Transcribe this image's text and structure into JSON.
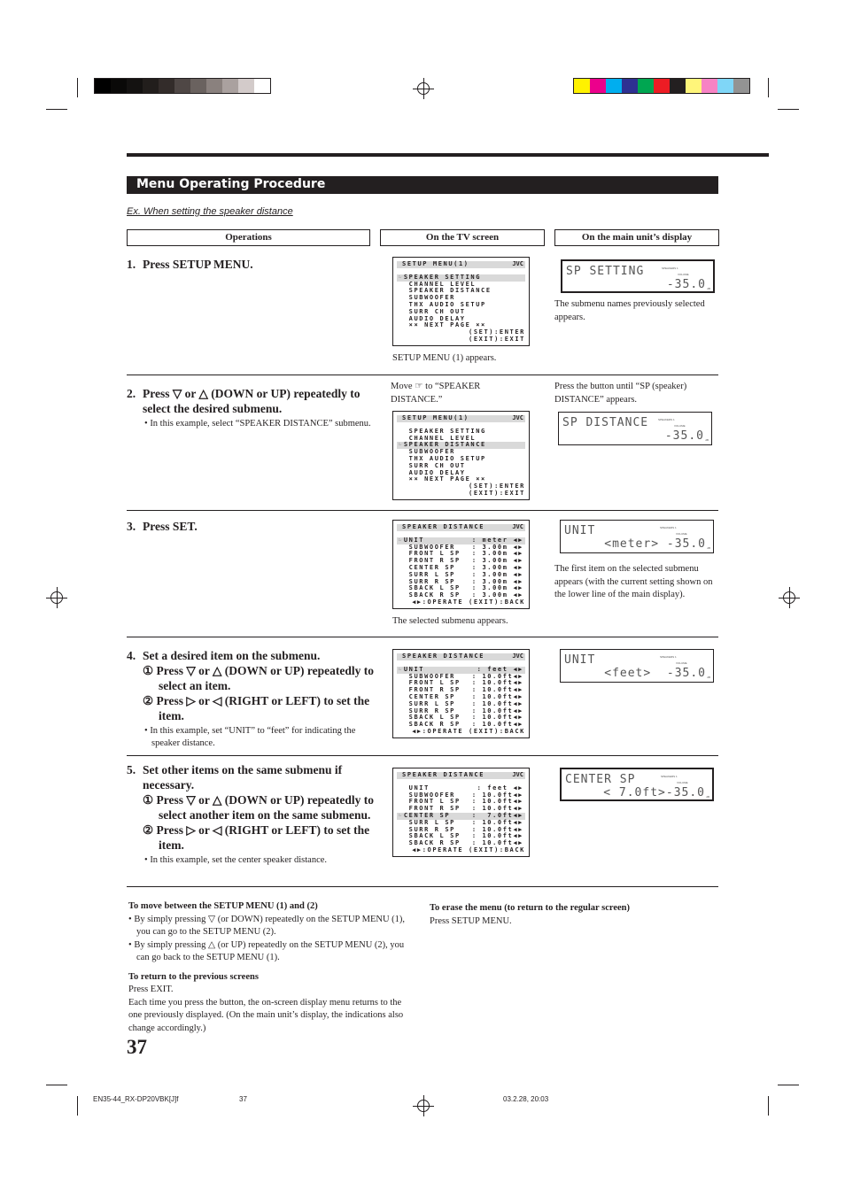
{
  "color_bars": {
    "gray": [
      "#000000",
      "#0a0908",
      "#141211",
      "#221e1c",
      "#332c2a",
      "#4f4745",
      "#6a625f",
      "#8a817e",
      "#aaa19f",
      "#d3cbca",
      "#ffffff"
    ],
    "color": [
      "#fff200",
      "#ec008c",
      "#00aeef",
      "#2e3192",
      "#00a651",
      "#ed1c24",
      "#231f20",
      "#fff57a",
      "#f783c4",
      "#7fd6f7",
      "#939393"
    ]
  },
  "header": {
    "title": "Menu Operating Procedure",
    "example": "Ex. When setting the speaker distance"
  },
  "columns": {
    "operations": "Operations",
    "tv": "On the TV screen",
    "display": "On the main unit’s display"
  },
  "steps": [
    {
      "num": "1.",
      "lines": [
        "Press SETUP MENU."
      ],
      "subs": [],
      "note": "",
      "tv_caption_top": "",
      "tv_caption": "SETUP MENU (1) appears.",
      "display_caption_top": "",
      "display_caption": "The submenu names previously selected appears."
    },
    {
      "num": "2.",
      "lines": [
        "Press ▽ or △ (DOWN or UP) repeatedly to select the desired submenu."
      ],
      "subs": [],
      "note": "In this example, select “SPEAKER DISTANCE” submenu.",
      "tv_caption_top": "Move ☞ to “SPEAKER DISTANCE.”",
      "tv_caption": "",
      "display_caption_top": "Press the button until “SP (speaker) DISTANCE” appears.",
      "display_caption": ""
    },
    {
      "num": "3.",
      "lines": [
        "Press SET."
      ],
      "subs": [],
      "note": "",
      "tv_caption_top": "",
      "tv_caption": "The selected submenu appears.",
      "display_caption_top": "",
      "display_caption": "The first item on the selected submenu appears (with the current setting shown on the lower line of the main display)."
    },
    {
      "num": "4.",
      "lines": [
        "Set a desired item on the submenu."
      ],
      "subs": [
        "① Press ▽ or △ (DOWN or UP) repeatedly to select an item.",
        "② Press ▷ or ◁ (RIGHT or LEFT) to set the item."
      ],
      "note": "In this example, set “UNIT” to “feet” for indicating the speaker distance.",
      "tv_caption_top": "",
      "tv_caption": "",
      "display_caption_top": "",
      "display_caption": ""
    },
    {
      "num": "5.",
      "lines": [
        "Set other items on the same submenu if necessary."
      ],
      "subs": [
        "① Press ▽ or △ (DOWN or UP) repeatedly to select another item on the same submenu.",
        "② Press ▷ or ◁ (RIGHT or LEFT) to set the item."
      ],
      "note": "In this example, set the center speaker distance.",
      "tv_caption_top": "",
      "tv_caption": "",
      "display_caption_top": "",
      "display_caption": ""
    }
  ],
  "tv_screens": [
    {
      "title": "SETUP MENU(1)",
      "brand": "JVC",
      "highlight": 0,
      "rows": [
        [
          "☞SPEAKER SETTING",
          ""
        ],
        [
          "  CHANNEL LEVEL",
          ""
        ],
        [
          "  SPEAKER DISTANCE",
          ""
        ],
        [
          "  SUBWOOFER",
          ""
        ],
        [
          "  THX AUDIO SETUP",
          ""
        ],
        [
          "  SURR CH OUT",
          ""
        ],
        [
          "  AUDIO DELAY",
          ""
        ],
        [
          "  ×× NEXT PAGE ××",
          ""
        ]
      ],
      "footer": [
        "(SET):ENTER",
        "(EXIT):EXIT"
      ]
    },
    {
      "title": "SETUP MENU(1)",
      "brand": "JVC",
      "highlight": 2,
      "rows": [
        [
          "  SPEAKER SETTING",
          ""
        ],
        [
          "  CHANNEL LEVEL",
          ""
        ],
        [
          "☞SPEAKER DISTANCE",
          ""
        ],
        [
          "  SUBWOOFER",
          ""
        ],
        [
          "  THX AUDIO SETUP",
          ""
        ],
        [
          "  SURR CH OUT",
          ""
        ],
        [
          "  AUDIO DELAY",
          ""
        ],
        [
          "  ×× NEXT PAGE ××",
          ""
        ]
      ],
      "footer": [
        "(SET):ENTER",
        "(EXIT):EXIT"
      ]
    },
    {
      "title": "SPEAKER DISTANCE",
      "brand": "JVC",
      "highlight": 0,
      "rows": [
        [
          "☞UNIT",
          ": meter ◀▶"
        ],
        [
          "  SUBWOOFER",
          ": 3.00m ◀▶"
        ],
        [
          "  FRONT L SP",
          ": 3.00m ◀▶"
        ],
        [
          "  FRONT R SP",
          ": 3.00m ◀▶"
        ],
        [
          "  CENTER SP",
          ": 3.00m ◀▶"
        ],
        [
          "  SURR L SP",
          ": 3.00m ◀▶"
        ],
        [
          "  SURR R SP",
          ": 3.00m ◀▶"
        ],
        [
          "  SBACK L SP",
          ": 3.00m ◀▶"
        ],
        [
          "  SBACK R SP",
          ": 3.00m ◀▶"
        ]
      ],
      "footer": [
        "◀▶:OPERATE (EXIT):BACK"
      ]
    },
    {
      "title": "SPEAKER DISTANCE",
      "brand": "JVC",
      "highlight": 0,
      "rows": [
        [
          "☞UNIT",
          ": feet ◀▶"
        ],
        [
          "  SUBWOOFER",
          ": 10.0ft◀▶"
        ],
        [
          "  FRONT L SP",
          ": 10.0ft◀▶"
        ],
        [
          "  FRONT R SP",
          ": 10.0ft◀▶"
        ],
        [
          "  CENTER SP",
          ": 10.0ft◀▶"
        ],
        [
          "  SURR L SP",
          ": 10.0ft◀▶"
        ],
        [
          "  SURR R SP",
          ": 10.0ft◀▶"
        ],
        [
          "  SBACK L SP",
          ": 10.0ft◀▶"
        ],
        [
          "  SBACK R SP",
          ": 10.0ft◀▶"
        ]
      ],
      "footer": [
        "◀▶:OPERATE (EXIT):BACK"
      ]
    },
    {
      "title": "SPEAKER DISTANCE",
      "brand": "JVC",
      "highlight": 4,
      "rows": [
        [
          "  UNIT",
          ": feet ◀▶"
        ],
        [
          "  SUBWOOFER",
          ": 10.0ft◀▶"
        ],
        [
          "  FRONT L SP",
          ": 10.0ft◀▶"
        ],
        [
          "  FRONT R SP",
          ": 10.0ft◀▶"
        ],
        [
          "☞CENTER SP",
          ":  7.0ft◀▶"
        ],
        [
          "  SURR L SP",
          ": 10.0ft◀▶"
        ],
        [
          "  SURR R SP",
          ": 10.0ft◀▶"
        ],
        [
          "  SBACK L SP",
          ": 10.0ft◀▶"
        ],
        [
          "  SBACK R SP",
          ": 10.0ft◀▶"
        ]
      ],
      "footer": [
        "◀▶:OPERATE (EXIT):BACK"
      ]
    }
  ],
  "displays": [
    {
      "line1": "SP SETTING",
      "line2": "-35.0",
      "indicator1": "SPEAKERS 1",
      "indicator2": "VOLUME",
      "unit": "dB"
    },
    {
      "line1": "SP DISTANCE",
      "line2": "-35.0",
      "indicator1": "SPEAKERS 1",
      "indicator2": "VOLUME",
      "unit": "dB"
    },
    {
      "line1": "UNIT",
      "line2": "<meter> -35.0",
      "indicator1": "SPEAKERS 1",
      "indicator2": "VOLUME",
      "unit": "dB"
    },
    {
      "line1": "UNIT",
      "line2": "<feet>  -35.0",
      "indicator1": "SPEAKERS 1",
      "indicator2": "VOLUME",
      "unit": "dB"
    },
    {
      "line1": "CENTER SP",
      "line2": "< 7.0ft>-35.0",
      "indicator1": "SPEAKERS 1",
      "indicator2": "VOLUME",
      "unit": "dB"
    }
  ],
  "notes": {
    "move_title": "To move between the SETUP MENU (1) and (2)",
    "move_bullets": [
      "By simply pressing ▽ (or DOWN) repeatedly on the SETUP MENU (1), you can go to the SETUP MENU (2).",
      "By simply pressing △ (or UP) repeatedly on the SETUP MENU (2), you can go back to the SETUP MENU (1)."
    ],
    "return_title": "To return to the previous screens",
    "return_line1": "Press EXIT.",
    "return_line2": "Each time you press the button, the on-screen display menu returns to the one previously displayed. (On the main unit’s display, the indications also change accordingly.)",
    "erase_title": "To erase the menu (to return to the regular screen)",
    "erase_line": "Press SETUP MENU."
  },
  "page_number": "37",
  "footer": {
    "file": "EN35-44_RX-DP20VBK[J]f",
    "page": "37",
    "timestamp": "03.2.28, 20:03"
  }
}
